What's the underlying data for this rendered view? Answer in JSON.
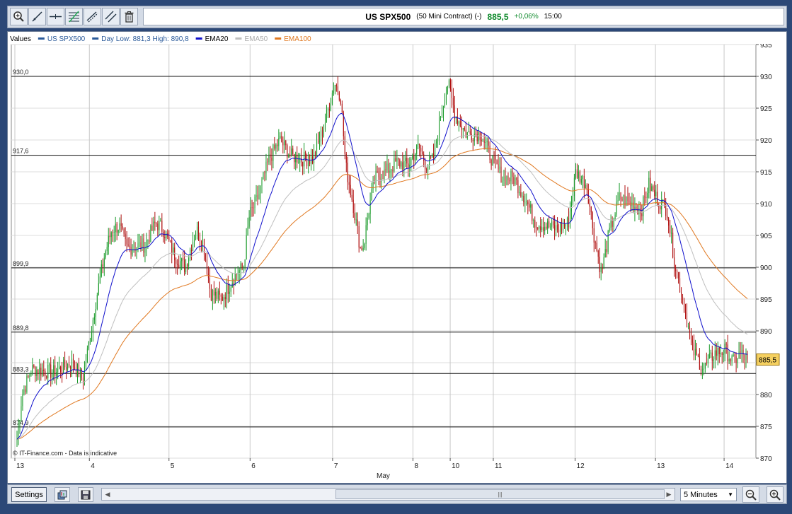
{
  "toolbar": {
    "tools": [
      {
        "name": "zoom-in-tool-icon"
      },
      {
        "name": "trend-line-icon"
      },
      {
        "name": "horizontal-line-icon"
      },
      {
        "name": "fibonacci-icon"
      },
      {
        "name": "channel-icon"
      },
      {
        "name": "parallel-lines-icon"
      },
      {
        "name": "trash-icon"
      }
    ],
    "symbol": "US SPX500",
    "description": "(50 Mini Contract) (-)",
    "price": "885,5",
    "change": "+0,06%",
    "time": "15:00"
  },
  "colors": {
    "price_up": "#1a9a2a",
    "price_down": "#b01010",
    "ema20": "#1010cc",
    "ema50": "#bfbfbf",
    "ema100": "#e07820",
    "legend_series": "#2a5a9a",
    "last_price_bg": "#f5d060"
  },
  "chart_data": {
    "type": "candlestick",
    "legend": [
      {
        "label": "Values",
        "color": ""
      },
      {
        "label": "US SPX500",
        "color": "#2a5a9a"
      },
      {
        "label": "Day Low: 881,3 High: 890,8",
        "color": "#2a5a9a"
      },
      {
        "label": "EMA20",
        "color": "#1010cc"
      },
      {
        "label": "EMA50",
        "color": "#bfbfbf"
      },
      {
        "label": "EMA100",
        "color": "#e07820"
      }
    ],
    "ylim": [
      870,
      935
    ],
    "y_ticks": [
      870,
      875,
      880,
      885,
      890,
      895,
      900,
      905,
      910,
      915,
      920,
      925,
      930,
      935
    ],
    "x_tick_labels": [
      "13",
      "4",
      "5",
      "6",
      "7",
      "8",
      "10",
      "11",
      "12",
      "13",
      "14"
    ],
    "x_tick_pos": [
      0.0,
      0.102,
      0.211,
      0.322,
      0.435,
      0.545,
      0.596,
      0.655,
      0.767,
      0.877,
      0.971
    ],
    "x_month_label": "May",
    "levels": [
      {
        "label": "930,0",
        "value": 930.0
      },
      {
        "label": "917,6",
        "value": 917.6
      },
      {
        "label": "899,9",
        "value": 899.9
      },
      {
        "label": "889,8",
        "value": 889.8
      },
      {
        "label": "883,3",
        "value": 883.3
      },
      {
        "label": "874,9",
        "value": 874.9
      }
    ],
    "last_price": 885.5,
    "last_price_label": "885,5",
    "anchors": [
      [
        0.0,
        873
      ],
      [
        0.007,
        880
      ],
      [
        0.02,
        884
      ],
      [
        0.05,
        883.5
      ],
      [
        0.075,
        885
      ],
      [
        0.09,
        882.5
      ],
      [
        0.1,
        889
      ],
      [
        0.11,
        896
      ],
      [
        0.12,
        902
      ],
      [
        0.13,
        906
      ],
      [
        0.14,
        906.5
      ],
      [
        0.15,
        903
      ],
      [
        0.175,
        903.5
      ],
      [
        0.19,
        907
      ],
      [
        0.2,
        906
      ],
      [
        0.215,
        902
      ],
      [
        0.23,
        900
      ],
      [
        0.245,
        906
      ],
      [
        0.255,
        904
      ],
      [
        0.265,
        896
      ],
      [
        0.28,
        895
      ],
      [
        0.3,
        899
      ],
      [
        0.31,
        900
      ],
      [
        0.318,
        908
      ],
      [
        0.33,
        911
      ],
      [
        0.345,
        917
      ],
      [
        0.36,
        920
      ],
      [
        0.375,
        917.5
      ],
      [
        0.39,
        917
      ],
      [
        0.405,
        917
      ],
      [
        0.42,
        922
      ],
      [
        0.435,
        929
      ],
      [
        0.443,
        927
      ],
      [
        0.45,
        916
      ],
      [
        0.46,
        910
      ],
      [
        0.47,
        903
      ],
      [
        0.475,
        903.5
      ],
      [
        0.48,
        908
      ],
      [
        0.49,
        914
      ],
      [
        0.505,
        915
      ],
      [
        0.52,
        916.5
      ],
      [
        0.535,
        916
      ],
      [
        0.55,
        919
      ],
      [
        0.56,
        916
      ],
      [
        0.57,
        917
      ],
      [
        0.58,
        924
      ],
      [
        0.59,
        929
      ],
      [
        0.6,
        924
      ],
      [
        0.615,
        921
      ],
      [
        0.635,
        921
      ],
      [
        0.65,
        917
      ],
      [
        0.665,
        914
      ],
      [
        0.68,
        914
      ],
      [
        0.695,
        911
      ],
      [
        0.71,
        907
      ],
      [
        0.725,
        906.5
      ],
      [
        0.74,
        906
      ],
      [
        0.755,
        907
      ],
      [
        0.765,
        915
      ],
      [
        0.78,
        913
      ],
      [
        0.79,
        905
      ],
      [
        0.8,
        899
      ],
      [
        0.81,
        905
      ],
      [
        0.825,
        911
      ],
      [
        0.84,
        910
      ],
      [
        0.855,
        909
      ],
      [
        0.865,
        913
      ],
      [
        0.875,
        911
      ],
      [
        0.89,
        909
      ],
      [
        0.9,
        901
      ],
      [
        0.915,
        893
      ],
      [
        0.925,
        887
      ],
      [
        0.94,
        884
      ],
      [
        0.955,
        886.5
      ],
      [
        0.97,
        887
      ],
      [
        0.98,
        885
      ],
      [
        0.99,
        886.5
      ],
      [
        1.0,
        885.5
      ]
    ],
    "watermark": "© IT-Finance.com - Data is indicative"
  },
  "bottombar": {
    "settings_label": "Settings",
    "interval_label": "5 Minutes",
    "scroll_thumb_glyph": "|||"
  }
}
